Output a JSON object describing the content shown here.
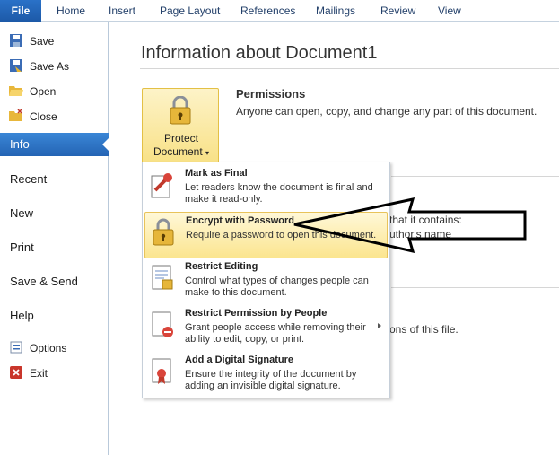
{
  "ribbon": {
    "tabs": [
      "File",
      "Home",
      "Insert",
      "Page Layout",
      "References",
      "Mailings",
      "Review",
      "View"
    ]
  },
  "sidebar": {
    "items": [
      {
        "label": "Save",
        "icon": "save-icon"
      },
      {
        "label": "Save As",
        "icon": "save-as-icon"
      },
      {
        "label": "Open",
        "icon": "open-folder-icon"
      },
      {
        "label": "Close",
        "icon": "close-folder-icon"
      }
    ],
    "selected": "Info",
    "sections": [
      "Recent",
      "New",
      "Print",
      "Save & Send",
      "Help"
    ],
    "bottom": [
      {
        "label": "Options",
        "icon": "options-icon"
      },
      {
        "label": "Exit",
        "icon": "exit-icon"
      }
    ]
  },
  "main": {
    "title": "Information about Document1",
    "protect_button": {
      "line1": "Protect",
      "line2": "Document"
    },
    "permissions": {
      "heading": "Permissions",
      "text": "Anyone can open, copy, and change any part of this document."
    },
    "bg": {
      "line1": "that it contains:",
      "line2": "uthor's name",
      "line3": "ons of this file."
    }
  },
  "menu": {
    "items": [
      {
        "title": "Mark as Final",
        "desc": "Let readers know the document is final and make it read-only.",
        "icon": "mark-final-icon"
      },
      {
        "title": "Encrypt with Password",
        "desc": "Require a password to open this document.",
        "icon": "lock-key-icon"
      },
      {
        "title": "Restrict Editing",
        "desc": "Control what types of changes people can make to this document.",
        "icon": "restrict-editing-icon"
      },
      {
        "title": "Restrict Permission by People",
        "desc": "Grant people access while removing their ability to edit, copy, or print.",
        "icon": "restrict-permission-icon"
      },
      {
        "title": "Add a Digital Signature",
        "desc": "Ensure the integrity of the document by adding an invisible digital signature.",
        "icon": "digital-signature-icon"
      }
    ]
  },
  "colors": {
    "file_tab": "#2a72c8",
    "selected_item": "#3a86d6",
    "highlight": "#fbe58f"
  }
}
